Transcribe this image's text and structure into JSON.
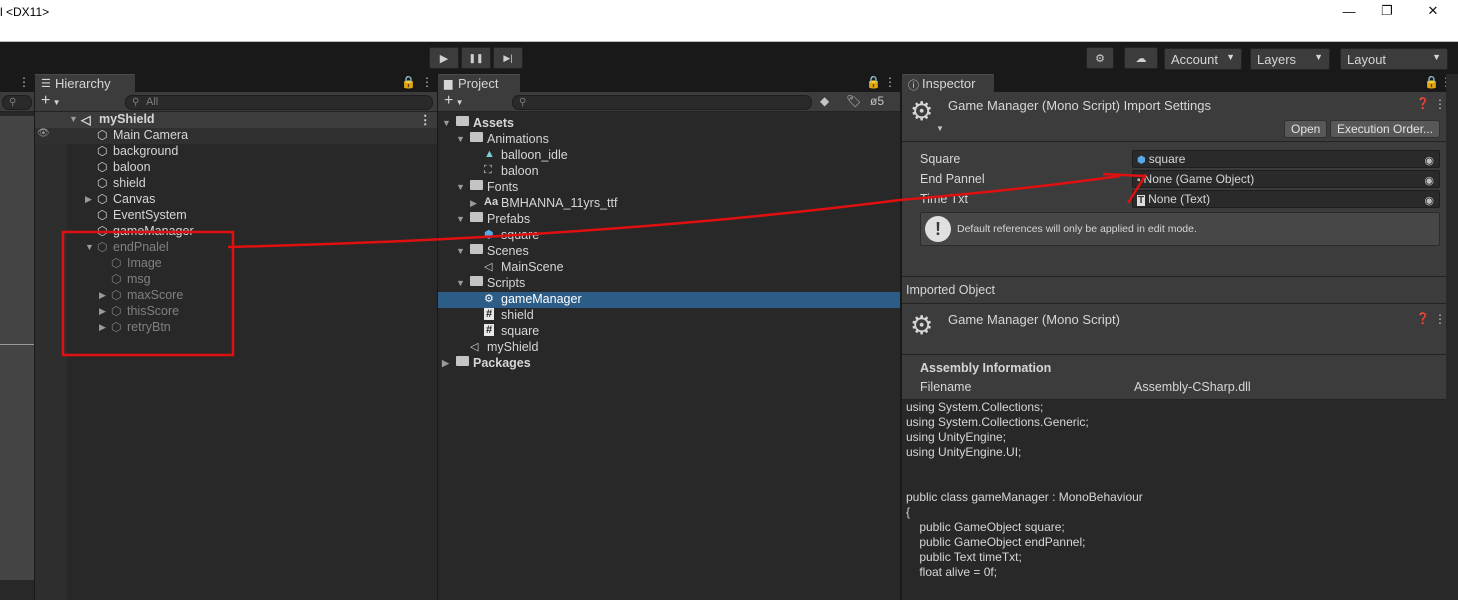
{
  "window": {
    "title": "l <DX11>",
    "minimize": "—",
    "maximize": "❐",
    "close": "✕"
  },
  "toolbar": {
    "play": "▶",
    "pause": "❚❚",
    "step": "▶|",
    "account": "Account",
    "layers": "Layers",
    "layout": "Layout"
  },
  "hierarchy": {
    "tab": "Hierarchy",
    "add": "+",
    "search_placeholder": "All",
    "scene": "myShield",
    "items": [
      {
        "label": "Main Camera",
        "level": 2
      },
      {
        "label": "background",
        "level": 2
      },
      {
        "label": "baloon",
        "level": 2
      },
      {
        "label": "shield",
        "level": 2
      },
      {
        "label": "Canvas",
        "level": 2
      },
      {
        "label": "EventSystem",
        "level": 2
      },
      {
        "label": "gameManager",
        "level": 2
      },
      {
        "label": "endPnalel",
        "level": 2
      },
      {
        "label": "Image",
        "level": 3
      },
      {
        "label": "msg",
        "level": 3
      },
      {
        "label": "maxScore",
        "level": 3
      },
      {
        "label": "thisScore",
        "level": 3
      },
      {
        "label": "retryBtn",
        "level": 3
      }
    ]
  },
  "project": {
    "tab": "Project",
    "add": "+",
    "hidden_count": "5",
    "items": [
      {
        "label": "Assets"
      },
      {
        "label": "Animations"
      },
      {
        "label": "balloon_idle"
      },
      {
        "label": "baloon"
      },
      {
        "label": "Fonts"
      },
      {
        "label": "BMHANNA_11yrs_ttf",
        "prefix": "Aa"
      },
      {
        "label": "Prefabs"
      },
      {
        "label": "square"
      },
      {
        "label": "Scenes"
      },
      {
        "label": "MainScene"
      },
      {
        "label": "Scripts"
      },
      {
        "label": "gameManager"
      },
      {
        "label": "shield"
      },
      {
        "label": "square"
      },
      {
        "label": "myShield"
      },
      {
        "label": "Packages"
      }
    ]
  },
  "inspector": {
    "tab": "Inspector",
    "header_title": "Game Manager (Mono Script) Import Settings",
    "open_button": "Open",
    "execution_order_button": "Execution Order...",
    "fields": [
      {
        "label": "Square",
        "value": "square"
      },
      {
        "label": "End Pannel",
        "value": "None (Game Object)"
      },
      {
        "label": "Time Txt",
        "value": "None (Text)"
      }
    ],
    "info_message": "Default references will only be applied in edit mode.",
    "imported_object_label": "Imported Object",
    "object_title": "Game Manager (Mono Script)",
    "assembly_heading": "Assembly Information",
    "filename_label": "Filename",
    "filename_value": "Assembly-CSharp.dll",
    "code": "using System.Collections;\nusing System.Collections.Generic;\nusing UnityEngine;\nusing UnityEngine.UI;\n\n\npublic class gameManager : MonoBehaviour\n{\n    public GameObject square;\n    public GameObject endPannel;\n    public Text timeTxt;\n    float alive = 0f;"
  },
  "annotation_color": "#e01010",
  "selection_color": "#2c5d87"
}
